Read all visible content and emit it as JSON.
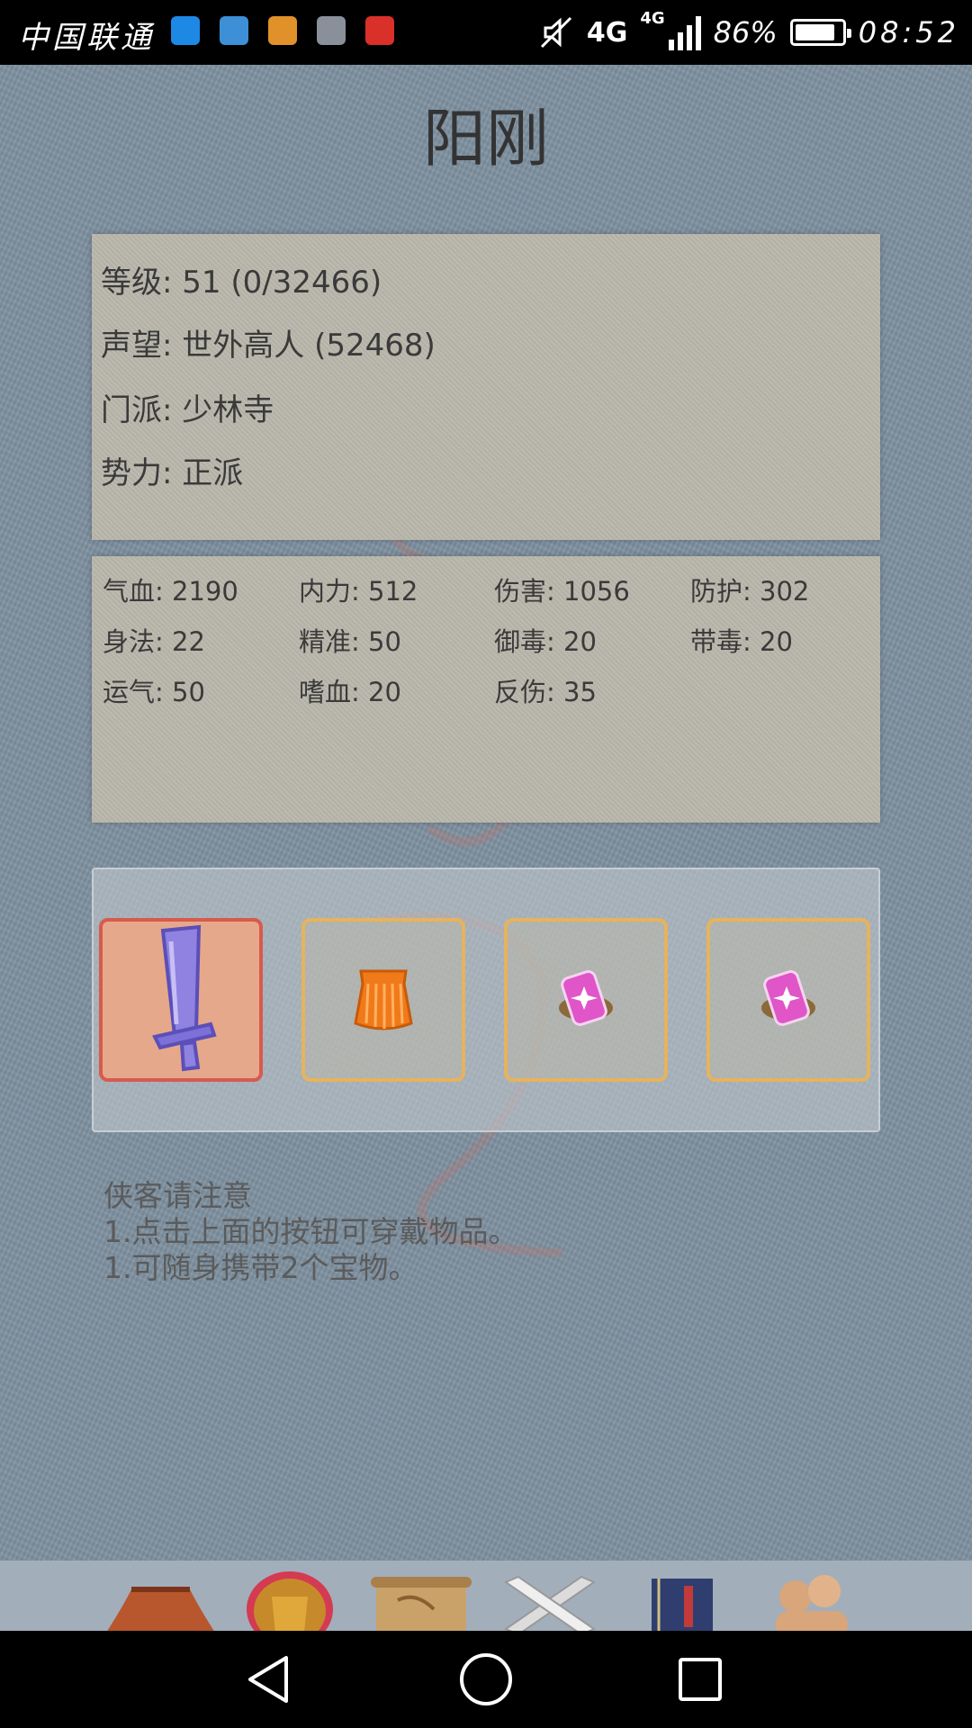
{
  "status_bar": {
    "carrier": "中国联通",
    "network_primary": "4G",
    "network_secondary": "4G",
    "battery_text": "86%",
    "battery_level": 0.86,
    "time": "08:52",
    "notification_icons": [
      "eyeu-app-icon",
      "health-app-icon",
      "clipboard-app-icon",
      "gallery-app-icon",
      "huawei-app-icon"
    ]
  },
  "character": {
    "name": "阳刚"
  },
  "info": {
    "level": "等级: 51 (0/32466)",
    "reputation": "声望: 世外高人 (52468)",
    "sect": "门派: 少林寺",
    "faction": "势力:  正派"
  },
  "stats": [
    "气血: 2190",
    "内力: 512",
    "伤害: 1056",
    "防护: 302",
    "身法: 22",
    "精准: 50",
    "御毒: 20",
    "带毒: 20",
    "运气: 50",
    "嗜血: 20",
    "反伤: 35"
  ],
  "equipment": [
    {
      "item": "sword-icon",
      "selected": true
    },
    {
      "item": "armor-robe-icon",
      "selected": false
    },
    {
      "item": "treasure-charm-icon",
      "selected": false
    },
    {
      "item": "treasure-charm-icon",
      "selected": false
    }
  ],
  "notice": {
    "title": "侠客请注意",
    "line1": "1.点击上面的按钮可穿戴物品。",
    "line2": "1.可随身携带2个宝物。"
  },
  "tabbar": [
    "home-building-icon",
    "character-armor-icon",
    "map-scroll-icon",
    "battle-swords-icon",
    "skill-book-icon",
    "friends-icon"
  ],
  "colors": {
    "background": "#7f91a1",
    "panel": "#b9b6ab",
    "slot_border": "#e6b35e",
    "slot_selected_border": "#d85a4e"
  }
}
